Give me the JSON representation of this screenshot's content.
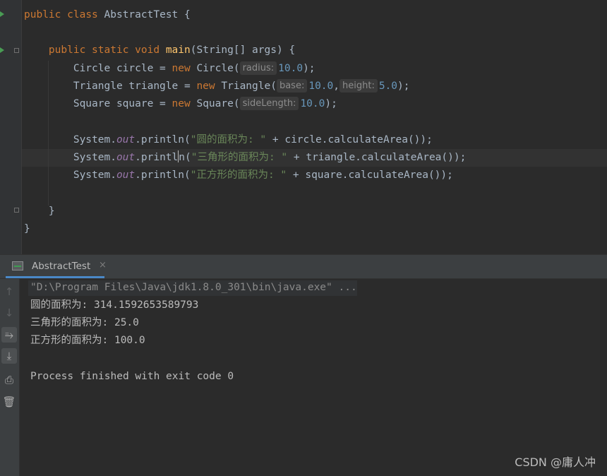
{
  "editor": {
    "line1": {
      "kw1": "public",
      "kw2": "class",
      "name": "AbstractTest",
      "brace": "{"
    },
    "line2": {
      "kw1": "public",
      "kw2": "static",
      "kw3": "void",
      "fn": "main",
      "params": "(String[] args) {"
    },
    "line3": {
      "lhs": "Circle circle = ",
      "kw": "new",
      "ctor": " Circle(",
      "hint": "radius:",
      "num": "10.0",
      "end": ");"
    },
    "line4": {
      "lhs": "Triangle triangle = ",
      "kw": "new",
      "ctor": " Triangle(",
      "hint1": "base:",
      "num1": "10.0",
      "sep": ",",
      "hint2": "height:",
      "num2": "5.0",
      "end": ");"
    },
    "line5": {
      "lhs": "Square square = ",
      "kw": "new",
      "ctor": " Square(",
      "hint": "sideLength:",
      "num": "10.0",
      "end": ");"
    },
    "println1": {
      "obj": "System.",
      "field": "out",
      "method": ".println(",
      "str": "\"圆的面积为: \"",
      "rest": " + circle.calculateArea());"
    },
    "println2": {
      "obj": "System.",
      "field": "out",
      "method_a": ".printl",
      "method_b": "n(",
      "str": "\"三角形的面积为: \"",
      "rest": " + triangle.calculateArea());"
    },
    "println3": {
      "obj": "System.",
      "field": "out",
      "method": ".println(",
      "str": "\"正方形的面积为: \"",
      "rest": " + square.calculateArea());"
    },
    "close_method": "}",
    "close_class": "}"
  },
  "run_panel": {
    "tab_label": "AbstractTest",
    "tab_close": "×",
    "output": {
      "command": "\"D:\\Program Files\\Java\\jdk1.8.0_301\\bin\\java.exe\" ...",
      "line1": "圆的面积为: 314.1592653589793",
      "line2": "三角形的面积为: 25.0",
      "line3": "正方形的面积为: 100.0",
      "exit": "Process finished with exit code 0"
    },
    "tools": {
      "up": "↑",
      "down": "↓",
      "wrap": "⥱",
      "scroll_end": "⤓",
      "print": "⎙",
      "trash": "🗑"
    }
  },
  "watermark": "CSDN @庸人冲",
  "colors": {
    "keyword": "#cc7832",
    "function": "#ffc66d",
    "number": "#6897bb",
    "string": "#6a8759",
    "field": "#9876aa",
    "text": "#a9b7c6"
  }
}
